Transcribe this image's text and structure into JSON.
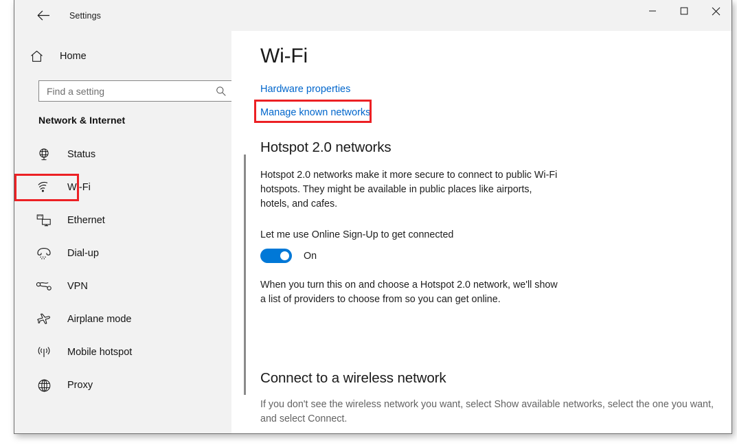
{
  "window": {
    "title": "Settings",
    "back_icon": "back-arrow-icon",
    "controls": {
      "minimize": "—",
      "maximize": "☐",
      "close": "✕"
    }
  },
  "sidebar": {
    "home_label": "Home",
    "home_icon": "home-icon",
    "search": {
      "placeholder": "Find a setting",
      "value": "",
      "icon": "search-icon"
    },
    "category": "Network & Internet",
    "items": [
      {
        "label": "Status",
        "icon": "globe-status-icon",
        "selected": false,
        "highlighted": false
      },
      {
        "label": "Wi-Fi",
        "icon": "wifi-icon",
        "selected": true,
        "highlighted": true
      },
      {
        "label": "Ethernet",
        "icon": "ethernet-icon",
        "selected": false,
        "highlighted": false
      },
      {
        "label": "Dial-up",
        "icon": "dialup-phone-icon",
        "selected": false,
        "highlighted": false
      },
      {
        "label": "VPN",
        "icon": "vpn-key-icon",
        "selected": false,
        "highlighted": false
      },
      {
        "label": "Airplane mode",
        "icon": "airplane-icon",
        "selected": false,
        "highlighted": false
      },
      {
        "label": "Mobile hotspot",
        "icon": "mobile-hotspot-icon",
        "selected": false,
        "highlighted": false
      },
      {
        "label": "Proxy",
        "icon": "globe-proxy-icon",
        "selected": false,
        "highlighted": false
      }
    ]
  },
  "main": {
    "page_title": "Wi-Fi",
    "links": [
      {
        "label": "Hardware properties",
        "highlighted": false
      },
      {
        "label": "Manage known networks",
        "highlighted": true
      }
    ],
    "hotspot_section": {
      "heading": "Hotspot 2.0 networks",
      "description": "Hotspot 2.0 networks make it more secure to connect to public Wi-Fi hotspots. They might be available in public places like airports, hotels, and cafes.",
      "toggle_label": "Let me use Online Sign-Up to get connected",
      "toggle_state": "On",
      "toggle_on": true,
      "note": "When you turn this on and choose a Hotspot 2.0 network, we'll show a list of providers to choose from so you can get online."
    },
    "connect_section": {
      "heading": "Connect to a wireless network",
      "description": "If you don't see the wireless network you want, select Show available networks, select the one you want, and select Connect."
    }
  },
  "colors": {
    "accent": "#0078d7",
    "link": "#0066cc",
    "highlight": "#ec2024",
    "sidebar_bg": "#f2f2f2"
  }
}
